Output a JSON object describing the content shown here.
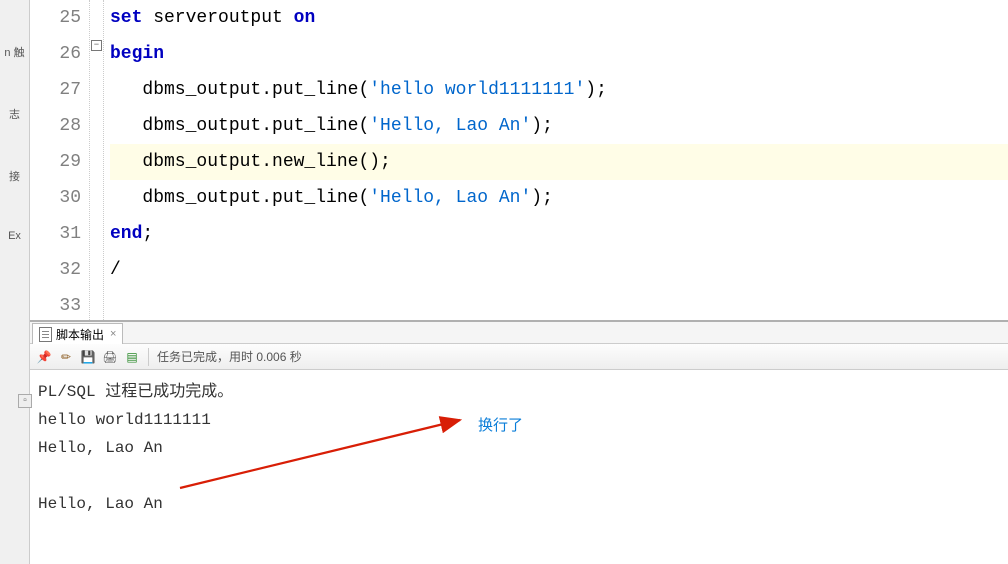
{
  "sidebar": {
    "labels": [
      "n 触",
      "志",
      "接",
      "Ex"
    ]
  },
  "editor": {
    "lines": [
      {
        "num": 25,
        "tokens": [
          {
            "cls": "kw",
            "txt": "set"
          },
          {
            "cls": "plain",
            "txt": " serveroutput "
          },
          {
            "cls": "kw",
            "txt": "on"
          }
        ]
      },
      {
        "num": 26,
        "fold": true,
        "tokens": [
          {
            "cls": "kw",
            "txt": "begin"
          }
        ]
      },
      {
        "num": 27,
        "tokens": [
          {
            "cls": "plain",
            "txt": "   dbms_output.put_line("
          },
          {
            "cls": "str",
            "txt": "'hello world1111111'"
          },
          {
            "cls": "plain",
            "txt": ");"
          }
        ]
      },
      {
        "num": 28,
        "tokens": [
          {
            "cls": "plain",
            "txt": "   dbms_output.put_line("
          },
          {
            "cls": "str",
            "txt": "'Hello, Lao An'"
          },
          {
            "cls": "plain",
            "txt": ");"
          }
        ]
      },
      {
        "num": 29,
        "highlight": true,
        "tokens": [
          {
            "cls": "plain",
            "txt": "   dbms_output.new_line();"
          }
        ]
      },
      {
        "num": 30,
        "tokens": [
          {
            "cls": "plain",
            "txt": "   dbms_output.put_line("
          },
          {
            "cls": "str",
            "txt": "'Hello, Lao An'"
          },
          {
            "cls": "plain",
            "txt": ");"
          }
        ]
      },
      {
        "num": 31,
        "tokens": [
          {
            "cls": "kw",
            "txt": "end"
          },
          {
            "cls": "plain",
            "txt": ";"
          }
        ]
      },
      {
        "num": 32,
        "tokens": [
          {
            "cls": "plain",
            "txt": "/"
          }
        ]
      },
      {
        "num": 33,
        "tokens": []
      }
    ]
  },
  "output": {
    "tab_label": "脚本输出",
    "toolbar_status": "任务已完成，用时 0.006 秒",
    "lines": [
      "PL/SQL 过程已成功完成。",
      "hello world1111111",
      "Hello, Lao An",
      "",
      "Hello, Lao An"
    ]
  },
  "annotation": {
    "label": "换行了"
  }
}
